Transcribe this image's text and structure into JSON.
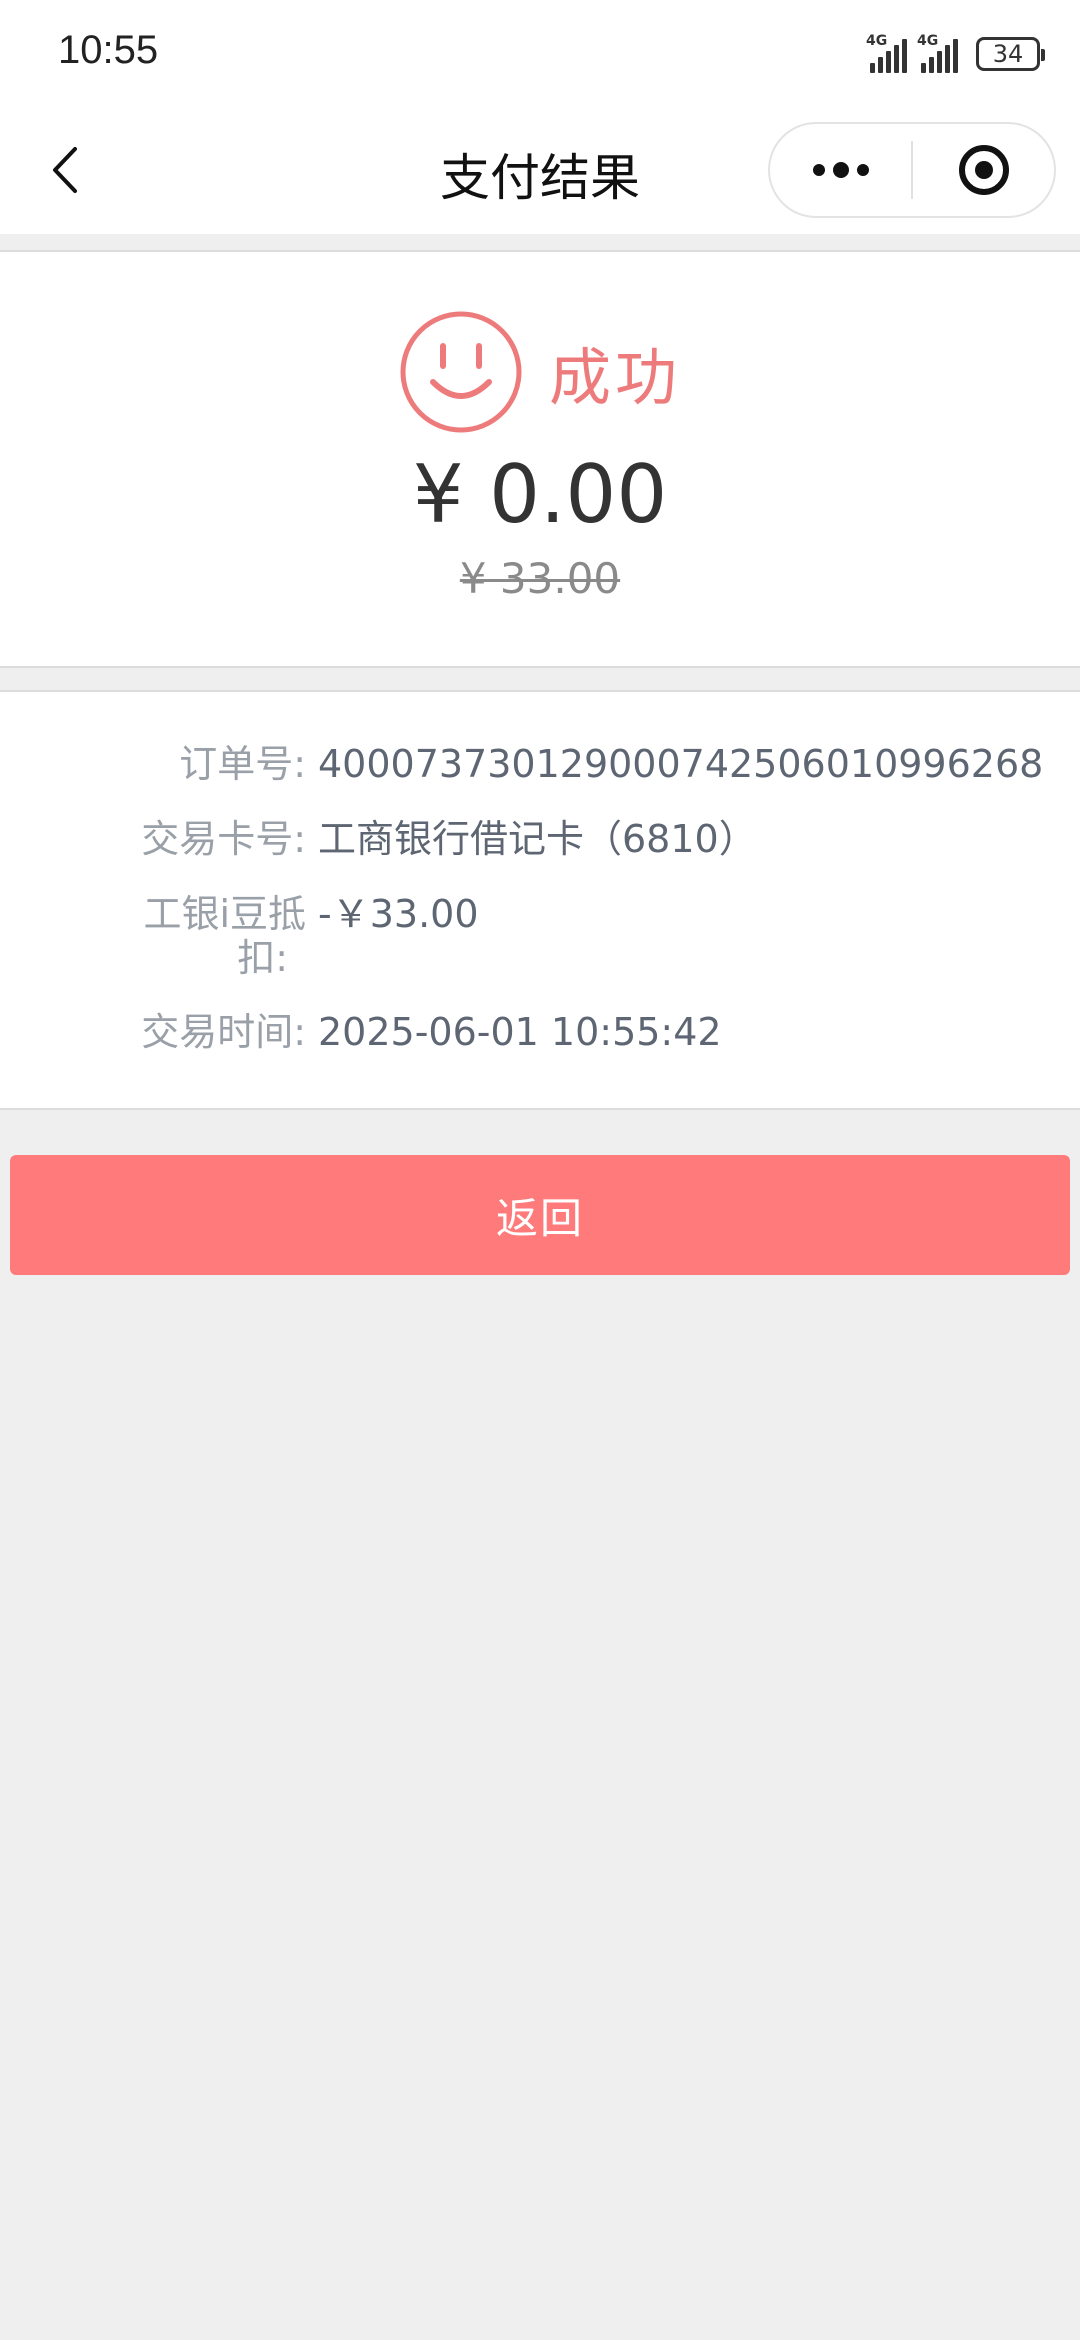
{
  "status_bar": {
    "time": "10:55",
    "network_1": "4G",
    "network_2": "4G",
    "battery": "34"
  },
  "nav": {
    "title": "支付结果",
    "back_icon": "chevron-left-icon",
    "more_icon": "more-dots-icon",
    "close_icon": "target-circle-icon"
  },
  "result": {
    "status_text": "成功",
    "status_icon": "smiley-face-icon",
    "amount": "¥ 0.00",
    "original_amount": "¥ 33.00",
    "accent_color": "#ee7b7b"
  },
  "details": {
    "order_no_label": "订单号:",
    "order_no_value": "4000737301290007425060109962​68",
    "card_label": "交易卡号:",
    "card_value": "工商银行借记卡（6810）",
    "discount_label_line1": "工银i豆抵",
    "discount_label_line2": "扣:",
    "discount_value": "-￥33.00",
    "time_label": "交易时间:",
    "time_value": "2025-06-01 10:55:42"
  },
  "actions": {
    "return_label": "返回",
    "return_color": "#ff7a7a"
  }
}
